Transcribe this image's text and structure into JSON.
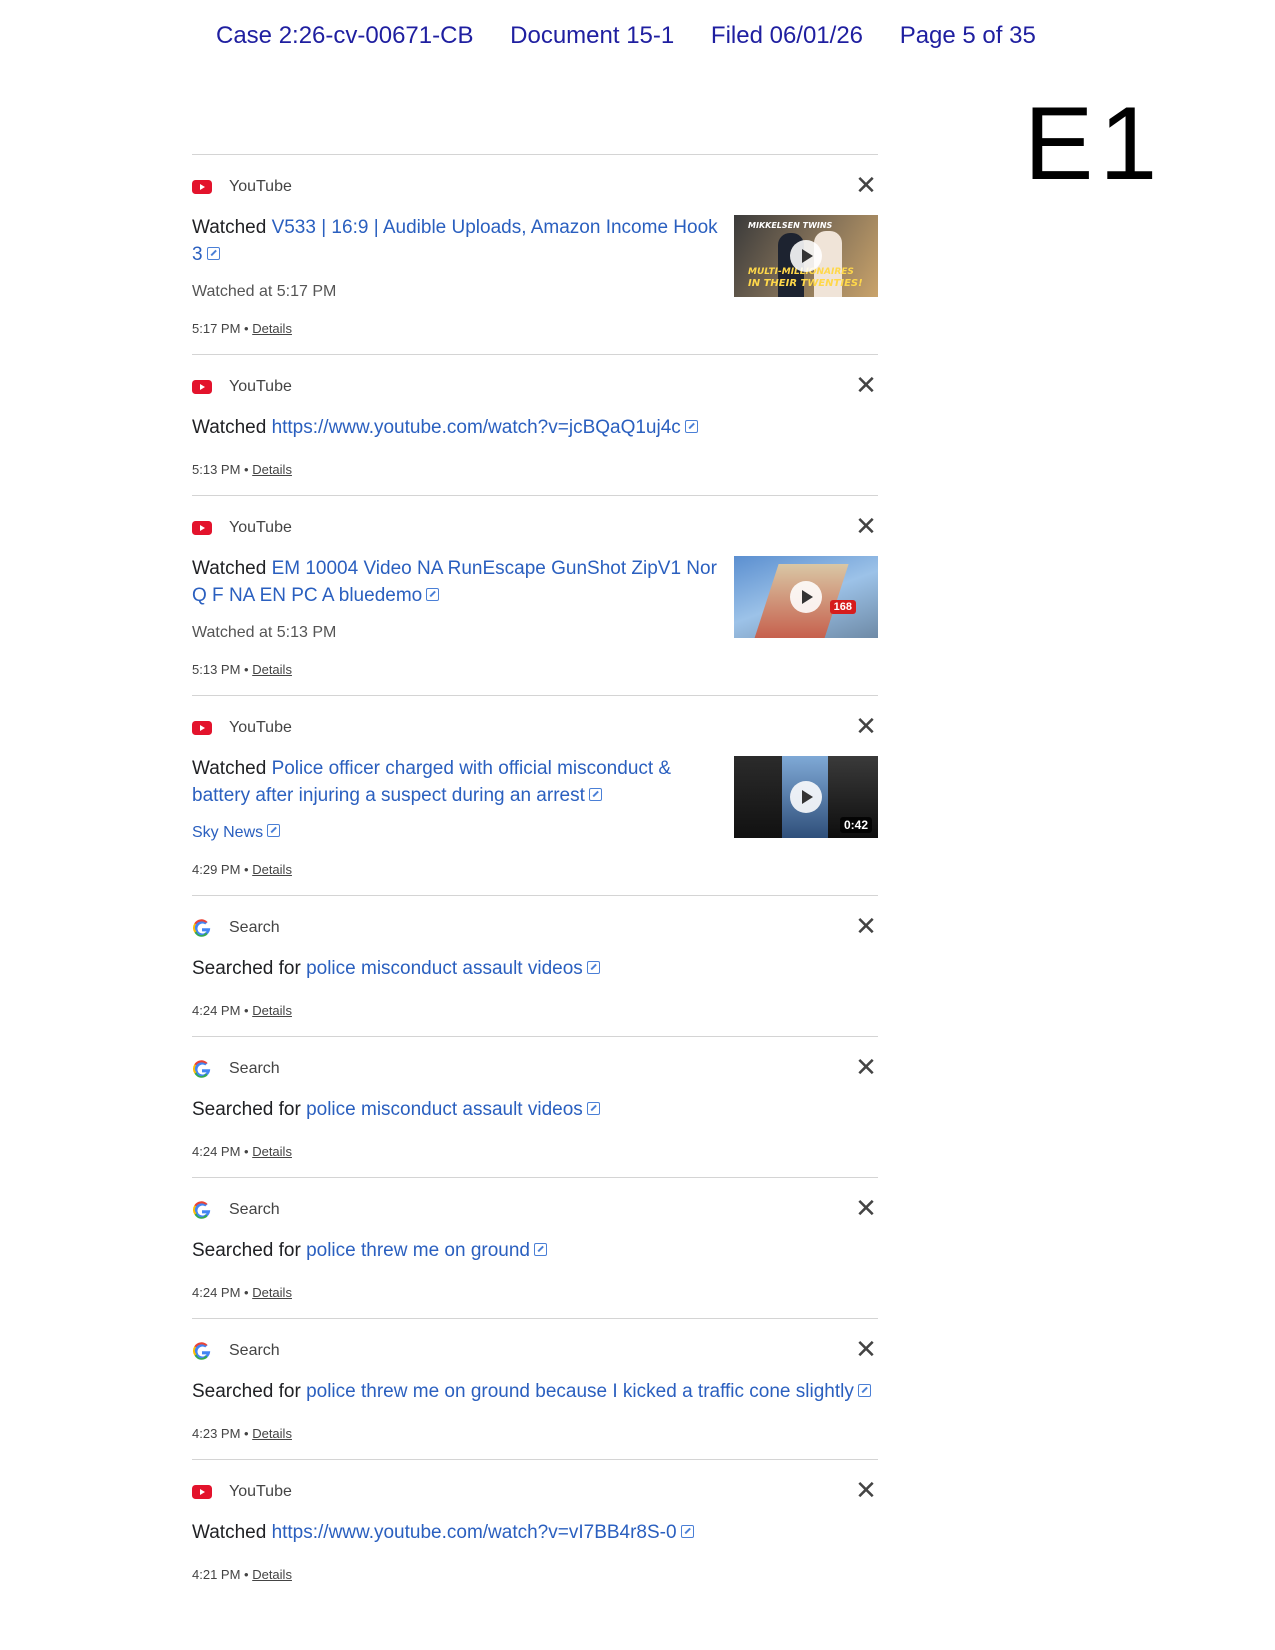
{
  "header": {
    "case": "Case 2:26-cv-00671-CB",
    "document": "Document 15-1",
    "filed": "Filed 06/01/26",
    "page": "Page 5 of 35"
  },
  "exhibit_label": "E1",
  "colors": {
    "header_text": "#1f1fa0",
    "link": "#2a5fbf",
    "youtube_red": "#e3132c"
  },
  "items": [
    {
      "source": "YouTube",
      "icon": "youtube-icon",
      "prefix": "Watched ",
      "link_text": "V533 | 16:9 | Audible Uploads, Amazon Income Hook 3",
      "sub": "Watched at 5:17 PM",
      "time": "5:17 PM",
      "details": "Details",
      "thumb_text_1": "MIKKELSEN TWINS",
      "thumb_text_2": "MULTI-MILLIONAIRES",
      "thumb_text_3": "IN THEIR TWENTIES!"
    },
    {
      "source": "YouTube",
      "icon": "youtube-icon",
      "prefix": "Watched ",
      "link_text": "https://www.youtube.com/watch?v=jcBQaQ1uj4c",
      "time": "5:13 PM",
      "details": "Details"
    },
    {
      "source": "YouTube",
      "icon": "youtube-icon",
      "prefix": "Watched ",
      "link_text": "EM 10004 Video NA RunEscape GunShot ZipV1 Nor Q F NA EN PC A bluedemo",
      "sub": "Watched at 5:13 PM",
      "time": "5:13 PM",
      "details": "Details",
      "thumb_number": "168"
    },
    {
      "source": "YouTube",
      "icon": "youtube-icon",
      "prefix": "Watched ",
      "link_text": "Police officer charged with official misconduct & battery after injuring a suspect during an arrest",
      "sub": "Sky News",
      "time": "4:29 PM",
      "details": "Details",
      "duration": "0:42"
    },
    {
      "source": "Search",
      "icon": "google-icon",
      "prefix": "Searched for ",
      "link_text": "police misconduct assault videos",
      "time": "4:24 PM",
      "details": "Details"
    },
    {
      "source": "Search",
      "icon": "google-icon",
      "prefix": "Searched for ",
      "link_text": "police misconduct assault videos",
      "time": "4:24 PM",
      "details": "Details"
    },
    {
      "source": "Search",
      "icon": "google-icon",
      "prefix": "Searched for ",
      "link_text": "police threw me on ground",
      "time": "4:24 PM",
      "details": "Details"
    },
    {
      "source": "Search",
      "icon": "google-icon",
      "prefix": "Searched for ",
      "link_text": "police threw me on ground because I kicked a traffic cone slightly",
      "time": "4:23 PM",
      "details": "Details"
    },
    {
      "source": "YouTube",
      "icon": "youtube-icon",
      "prefix": "Watched ",
      "link_text": "https://www.youtube.com/watch?v=vI7BB4r8S-0",
      "time": "4:21 PM",
      "details": "Details"
    }
  ],
  "close_icon": "close-icon",
  "separator": " • "
}
